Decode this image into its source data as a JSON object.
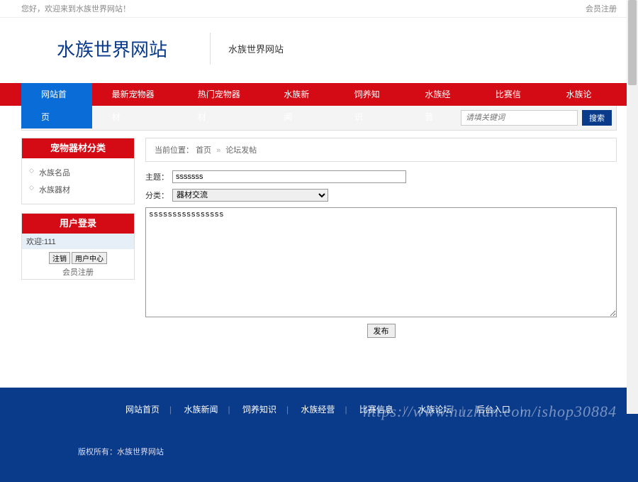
{
  "topbar": {
    "greeting": "您好，欢迎来到水族世界网站！",
    "register": "会员注册"
  },
  "header": {
    "logo": "水族世界网站",
    "subtitle": "水族世界网站"
  },
  "nav": {
    "items": [
      {
        "label": "网站首页",
        "active": true
      },
      {
        "label": "最新宠物器材"
      },
      {
        "label": "热门宠物器材"
      },
      {
        "label": "水族新闻"
      },
      {
        "label": "饲养知识"
      },
      {
        "label": "水族经营"
      },
      {
        "label": "比赛信息"
      },
      {
        "label": "水族论坛"
      }
    ]
  },
  "search": {
    "placeholder": "请填关键词",
    "button": "搜索"
  },
  "sidebar": {
    "category": {
      "title": "宠物器材分类",
      "items": [
        "水族名品",
        "水族器材"
      ]
    },
    "login": {
      "title": "用户登录",
      "welcome": "欢迎:111",
      "logout_btn": "注销",
      "center_btn": "用户中心",
      "register": "会员注册"
    }
  },
  "breadcrumb": {
    "prefix": "当前位置：",
    "home": "首页",
    "sep": "»",
    "current": "论坛发帖"
  },
  "form": {
    "subject_label": "主题：",
    "subject_value": "sssssss",
    "category_label": "分类：",
    "category_value": "器材交流",
    "content_value": "ssssssssssssssss",
    "submit": "发布"
  },
  "footer": {
    "links": [
      "网站首页",
      "水族新闻",
      "饲养知识",
      "水族经营",
      "比赛信息",
      "水族论坛",
      "后台入口"
    ],
    "copyright": "版权所有：水族世界网站",
    "watermark": "https://www.huzhan.com/ishop30884"
  }
}
